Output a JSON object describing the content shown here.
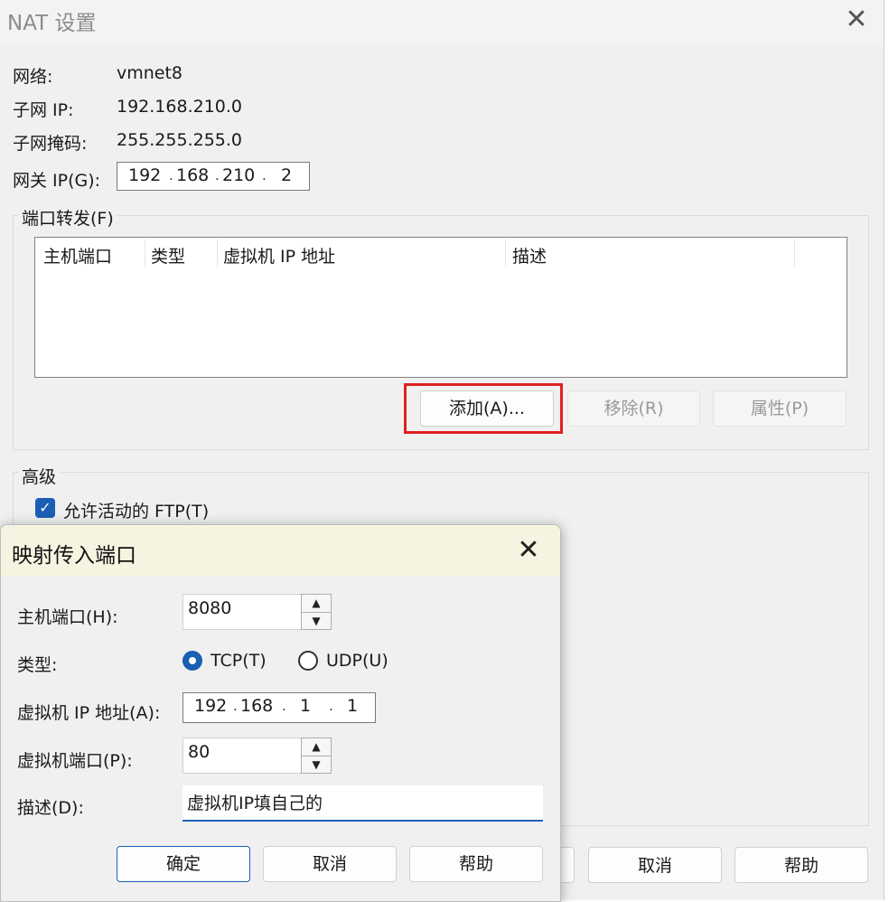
{
  "nat_window": {
    "title": "NAT 设置",
    "network_label": "网络:",
    "network_value": "vmnet8",
    "subnet_ip_label": "子网 IP:",
    "subnet_ip_value": "192.168.210.0",
    "subnet_mask_label": "子网掩码:",
    "subnet_mask_value": "255.255.255.0",
    "gateway_label": "网关 IP(G):",
    "gateway_octets": [
      "192",
      "168",
      "210",
      "2"
    ],
    "port_forwarding": {
      "title": "端口转发(F)",
      "columns": [
        "主机端口",
        "类型",
        "虚拟机 IP 地址",
        "描述"
      ],
      "add_button": "添加(A)...",
      "remove_button": "移除(R)",
      "properties_button": "属性(P)"
    },
    "advanced": {
      "title": "高级",
      "allow_active_ftp": "允许活动的 FTP(T)",
      "allow_active_ftp_checked": true
    },
    "footer": {
      "cancel_button": "取消",
      "help_button": "帮助"
    }
  },
  "map_dialog": {
    "title": "映射传入端口",
    "host_port_label": "主机端口(H):",
    "host_port_value": "8080",
    "type_label": "类型:",
    "tcp_label": "TCP(T)",
    "udp_label": "UDP(U)",
    "selected_type": "TCP",
    "vm_ip_label": "虚拟机 IP 地址(A):",
    "vm_ip_octets": [
      "192",
      "168",
      "1",
      "1"
    ],
    "vm_port_label": "虚拟机端口(P):",
    "vm_port_value": "80",
    "desc_label": "描述(D):",
    "desc_value": "虚拟机IP填自己的",
    "ok_button": "确定",
    "cancel_button": "取消",
    "help_button": "帮助"
  },
  "colors": {
    "highlight_border": "#e02020",
    "accent": "#1a5fb4",
    "dialog_titlebar": "#f6f3e0"
  }
}
